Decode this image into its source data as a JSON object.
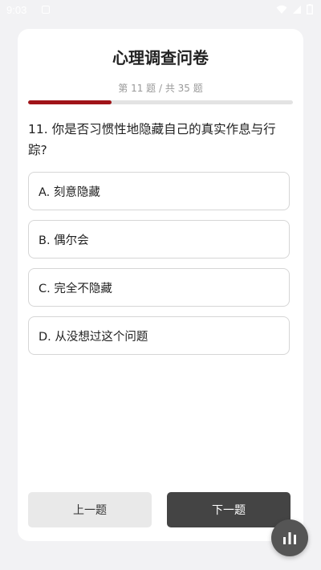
{
  "status_bar": {
    "time": "9:03"
  },
  "survey": {
    "title": "心理调查问卷",
    "progress_text": "第 11 题 / 共 35 题",
    "progress_fraction": 0.314,
    "accent_color": "#a01418"
  },
  "question": {
    "text": "11. 你是否习惯性地隐藏自己的真实作息与行踪?",
    "options": [
      "A. 刻意隐藏",
      "B. 偶尔会",
      "C. 完全不隐藏",
      "D. 从没想过这个问题"
    ]
  },
  "nav": {
    "prev_label": "上一题",
    "next_label": "下一题"
  },
  "fab": {
    "icon": "bar-chart-icon"
  }
}
